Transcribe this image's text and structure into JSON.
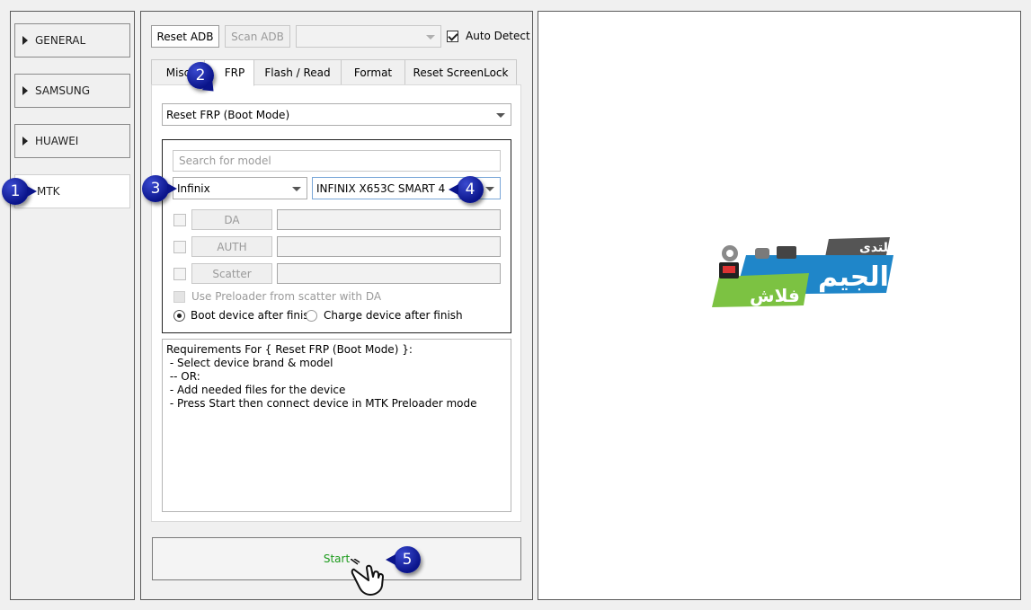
{
  "sidebar": {
    "items": [
      {
        "label": "GENERAL"
      },
      {
        "label": "SAMSUNG"
      },
      {
        "label": "HUAWEI"
      },
      {
        "label": "MTK"
      }
    ]
  },
  "toolbar": {
    "reset_adb": "Reset ADB",
    "scan_adb": "Scan ADB",
    "port_select_value": "",
    "auto_detect_label": "Auto Detect",
    "auto_detect_checked": true
  },
  "tabs": [
    {
      "label": "Misc"
    },
    {
      "label": "FRP"
    },
    {
      "label": "Flash / Read"
    },
    {
      "label": "Format"
    },
    {
      "label": "Reset ScreenLock"
    }
  ],
  "frp": {
    "operation_value": "Reset FRP (Boot Mode)",
    "search_placeholder": "Search for model",
    "brand_value": "Infinix",
    "model_value": "INFINIX X653C SMART 4",
    "da_button": "DA",
    "auth_button": "AUTH",
    "scatter_button": "Scatter",
    "da_path": "",
    "auth_path": "",
    "scatter_path": "",
    "use_preloader_label": "Use Preloader from scatter with DA",
    "boot_after_finish_label": "Boot device after finish",
    "charge_after_finish_label": "Charge device after finish",
    "requirements_text": "Requirements For { Reset FRP (Boot Mode) }:\n - Select device brand & model\n -- OR:\n - Add needed files for the device\n - Press Start then connect device in MTK Preloader mode"
  },
  "start_button": "Start",
  "markers": [
    "1",
    "2",
    "3",
    "4",
    "5"
  ],
  "logo": {
    "top_text": "ملتدى",
    "main_text": "الجيم",
    "sub_text": "فلاش"
  },
  "colors": {
    "start_text": "#1a9a1a",
    "marker": "#0a148a",
    "logo_blue": "#1f86c9",
    "logo_green": "#7cc242"
  },
  "icons": [
    "chevron-down-icon",
    "triangle-right-icon",
    "hand-pointer-icon",
    "check-icon"
  ]
}
